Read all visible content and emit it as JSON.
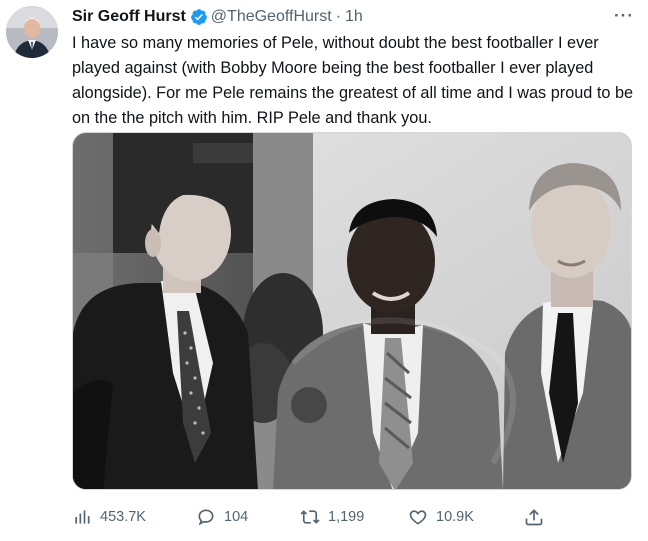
{
  "tweet": {
    "author_name": "Sir Geoff Hurst",
    "handle": "@TheGeoffHurst",
    "separator": "·",
    "time": "1h",
    "more_label": "···",
    "text": "I have so many memories of Pele, without doubt the best footballer I ever played against (with Bobby Moore being the best footballer I ever played alongside). For me Pele remains the greatest of all time and I was proud to be on the the pitch with him. RIP Pele and thank you."
  },
  "actions": {
    "views": "453.7K",
    "replies": "104",
    "retweets": "1,199",
    "likes": "10.9K"
  },
  "icons": {
    "verified": "verified-badge-icon",
    "views": "bar-chart-icon",
    "replies": "speech-bubble-icon",
    "retweets": "retweet-icon",
    "likes": "heart-icon",
    "share": "share-icon",
    "more": "ellipsis-icon"
  },
  "colors": {
    "verified": "#1d9bf0",
    "text": "#0f1419",
    "secondary": "#536471"
  }
}
